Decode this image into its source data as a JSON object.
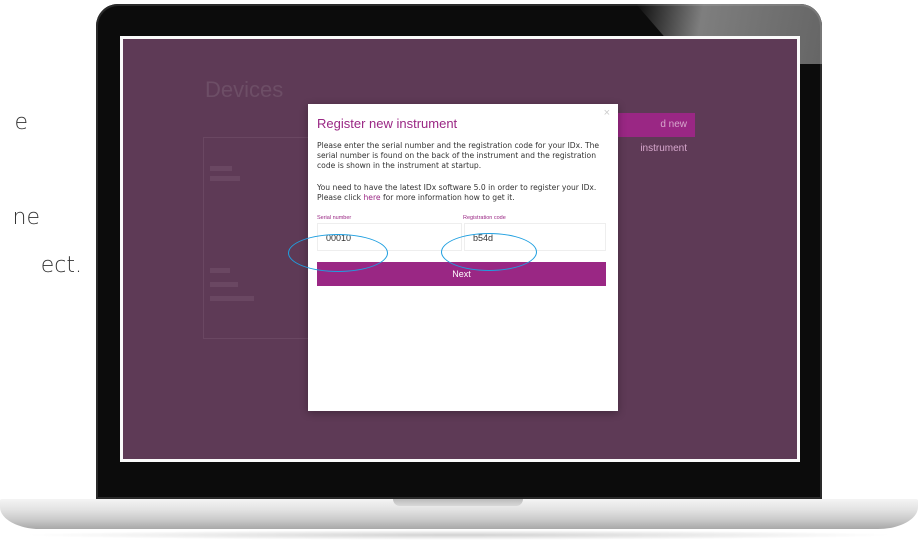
{
  "side_captions": [
    "e",
    "ne",
    "ect."
  ],
  "background_app": {
    "page_title": "Devices",
    "add_button_label": "d new instrument"
  },
  "modal": {
    "close_glyph": "×",
    "title": "Register new instrument",
    "paragraph1": "Please enter the serial number and the registration code for your IDx. The serial number is found on the back of the instrument and the registration code is shown in the instrument at startup.",
    "paragraph2_before": "You need to have the latest IDx software 5.0 in order to register your IDx. Please click ",
    "paragraph2_link": "here",
    "paragraph2_after": " for more information how to get it.",
    "serial_label": "Serial number",
    "serial_value": "00010",
    "registration_label": "Registration code",
    "registration_value": "b54d",
    "next_label": "Next"
  },
  "colors": {
    "accent": "#9a2784",
    "overlay": "#5e3a56",
    "highlight": "#1f9fe0"
  }
}
